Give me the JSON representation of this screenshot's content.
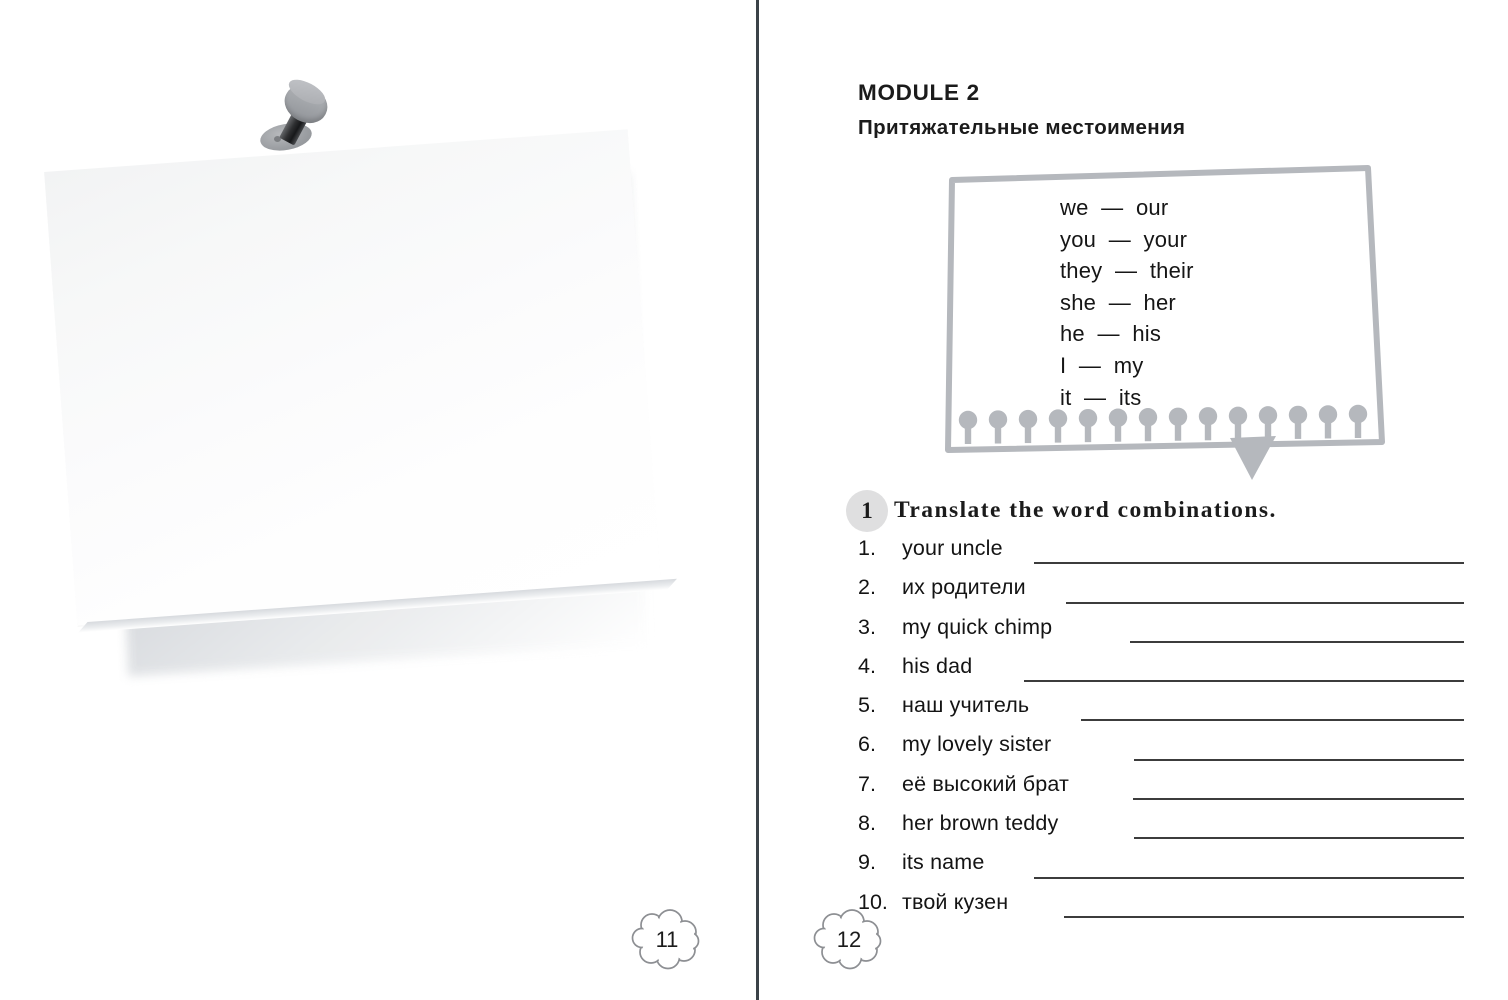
{
  "spread": {
    "left_page": {
      "page_number": "11",
      "illustration": "blank-sticky-note-with-pushpin"
    },
    "right_page": {
      "page_number": "12",
      "module_title": "MODULE 2",
      "module_subtitle": "Притяжательные местоимения",
      "pronoun_box": {
        "pairs": [
          "we  —  our",
          "you  —  your",
          "they  —  their",
          "she  —  her",
          "he  —  his",
          "I  —  my",
          "it  —  its"
        ],
        "border_color": "#b5b8bd",
        "fringe_dot_count": 14
      },
      "exercise": {
        "number": "1",
        "instruction": "Translate the word combinations.",
        "items": [
          {
            "num": "1.",
            "text": "your uncle",
            "rule_width": 430
          },
          {
            "num": "2.",
            "text": "их родители",
            "rule_width": 398
          },
          {
            "num": "3.",
            "text": "my quick chimp",
            "rule_width": 334
          },
          {
            "num": "4.",
            "text": "his dad",
            "rule_width": 440
          },
          {
            "num": "5.",
            "text": "наш учитель",
            "rule_width": 383
          },
          {
            "num": "6.",
            "text": "my lovely sister",
            "rule_width": 330
          },
          {
            "num": "7.",
            "text": "её высокий брат",
            "rule_width": 331
          },
          {
            "num": "8.",
            "text": "her brown teddy",
            "rule_width": 330
          },
          {
            "num": "9.",
            "text": "its name",
            "rule_width": 430
          },
          {
            "num": "10.",
            "text": "твой кузен",
            "rule_width": 400
          }
        ]
      }
    },
    "gutter_color": "#3b4248"
  }
}
